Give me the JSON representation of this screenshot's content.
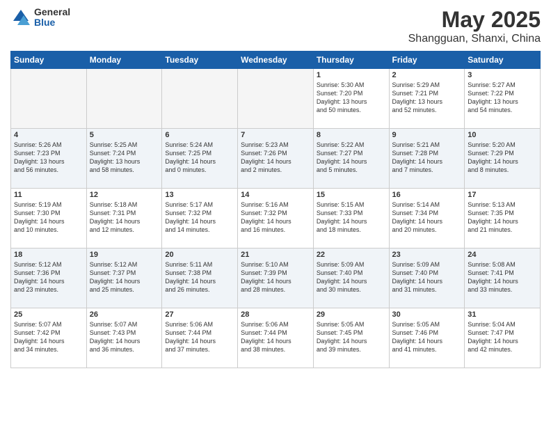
{
  "logo": {
    "general": "General",
    "blue": "Blue"
  },
  "title": {
    "month_year": "May 2025",
    "location": "Shangguan, Shanxi, China"
  },
  "days_of_week": [
    "Sunday",
    "Monday",
    "Tuesday",
    "Wednesday",
    "Thursday",
    "Friday",
    "Saturday"
  ],
  "weeks": [
    [
      {
        "day": "",
        "info": ""
      },
      {
        "day": "",
        "info": ""
      },
      {
        "day": "",
        "info": ""
      },
      {
        "day": "",
        "info": ""
      },
      {
        "day": "1",
        "info": "Sunrise: 5:30 AM\nSunset: 7:20 PM\nDaylight: 13 hours\nand 50 minutes."
      },
      {
        "day": "2",
        "info": "Sunrise: 5:29 AM\nSunset: 7:21 PM\nDaylight: 13 hours\nand 52 minutes."
      },
      {
        "day": "3",
        "info": "Sunrise: 5:27 AM\nSunset: 7:22 PM\nDaylight: 13 hours\nand 54 minutes."
      }
    ],
    [
      {
        "day": "4",
        "info": "Sunrise: 5:26 AM\nSunset: 7:23 PM\nDaylight: 13 hours\nand 56 minutes."
      },
      {
        "day": "5",
        "info": "Sunrise: 5:25 AM\nSunset: 7:24 PM\nDaylight: 13 hours\nand 58 minutes."
      },
      {
        "day": "6",
        "info": "Sunrise: 5:24 AM\nSunset: 7:25 PM\nDaylight: 14 hours\nand 0 minutes."
      },
      {
        "day": "7",
        "info": "Sunrise: 5:23 AM\nSunset: 7:26 PM\nDaylight: 14 hours\nand 2 minutes."
      },
      {
        "day": "8",
        "info": "Sunrise: 5:22 AM\nSunset: 7:27 PM\nDaylight: 14 hours\nand 5 minutes."
      },
      {
        "day": "9",
        "info": "Sunrise: 5:21 AM\nSunset: 7:28 PM\nDaylight: 14 hours\nand 7 minutes."
      },
      {
        "day": "10",
        "info": "Sunrise: 5:20 AM\nSunset: 7:29 PM\nDaylight: 14 hours\nand 8 minutes."
      }
    ],
    [
      {
        "day": "11",
        "info": "Sunrise: 5:19 AM\nSunset: 7:30 PM\nDaylight: 14 hours\nand 10 minutes."
      },
      {
        "day": "12",
        "info": "Sunrise: 5:18 AM\nSunset: 7:31 PM\nDaylight: 14 hours\nand 12 minutes."
      },
      {
        "day": "13",
        "info": "Sunrise: 5:17 AM\nSunset: 7:32 PM\nDaylight: 14 hours\nand 14 minutes."
      },
      {
        "day": "14",
        "info": "Sunrise: 5:16 AM\nSunset: 7:32 PM\nDaylight: 14 hours\nand 16 minutes."
      },
      {
        "day": "15",
        "info": "Sunrise: 5:15 AM\nSunset: 7:33 PM\nDaylight: 14 hours\nand 18 minutes."
      },
      {
        "day": "16",
        "info": "Sunrise: 5:14 AM\nSunset: 7:34 PM\nDaylight: 14 hours\nand 20 minutes."
      },
      {
        "day": "17",
        "info": "Sunrise: 5:13 AM\nSunset: 7:35 PM\nDaylight: 14 hours\nand 21 minutes."
      }
    ],
    [
      {
        "day": "18",
        "info": "Sunrise: 5:12 AM\nSunset: 7:36 PM\nDaylight: 14 hours\nand 23 minutes."
      },
      {
        "day": "19",
        "info": "Sunrise: 5:12 AM\nSunset: 7:37 PM\nDaylight: 14 hours\nand 25 minutes."
      },
      {
        "day": "20",
        "info": "Sunrise: 5:11 AM\nSunset: 7:38 PM\nDaylight: 14 hours\nand 26 minutes."
      },
      {
        "day": "21",
        "info": "Sunrise: 5:10 AM\nSunset: 7:39 PM\nDaylight: 14 hours\nand 28 minutes."
      },
      {
        "day": "22",
        "info": "Sunrise: 5:09 AM\nSunset: 7:40 PM\nDaylight: 14 hours\nand 30 minutes."
      },
      {
        "day": "23",
        "info": "Sunrise: 5:09 AM\nSunset: 7:40 PM\nDaylight: 14 hours\nand 31 minutes."
      },
      {
        "day": "24",
        "info": "Sunrise: 5:08 AM\nSunset: 7:41 PM\nDaylight: 14 hours\nand 33 minutes."
      }
    ],
    [
      {
        "day": "25",
        "info": "Sunrise: 5:07 AM\nSunset: 7:42 PM\nDaylight: 14 hours\nand 34 minutes."
      },
      {
        "day": "26",
        "info": "Sunrise: 5:07 AM\nSunset: 7:43 PM\nDaylight: 14 hours\nand 36 minutes."
      },
      {
        "day": "27",
        "info": "Sunrise: 5:06 AM\nSunset: 7:44 PM\nDaylight: 14 hours\nand 37 minutes."
      },
      {
        "day": "28",
        "info": "Sunrise: 5:06 AM\nSunset: 7:44 PM\nDaylight: 14 hours\nand 38 minutes."
      },
      {
        "day": "29",
        "info": "Sunrise: 5:05 AM\nSunset: 7:45 PM\nDaylight: 14 hours\nand 39 minutes."
      },
      {
        "day": "30",
        "info": "Sunrise: 5:05 AM\nSunset: 7:46 PM\nDaylight: 14 hours\nand 41 minutes."
      },
      {
        "day": "31",
        "info": "Sunrise: 5:04 AM\nSunset: 7:47 PM\nDaylight: 14 hours\nand 42 minutes."
      }
    ]
  ]
}
